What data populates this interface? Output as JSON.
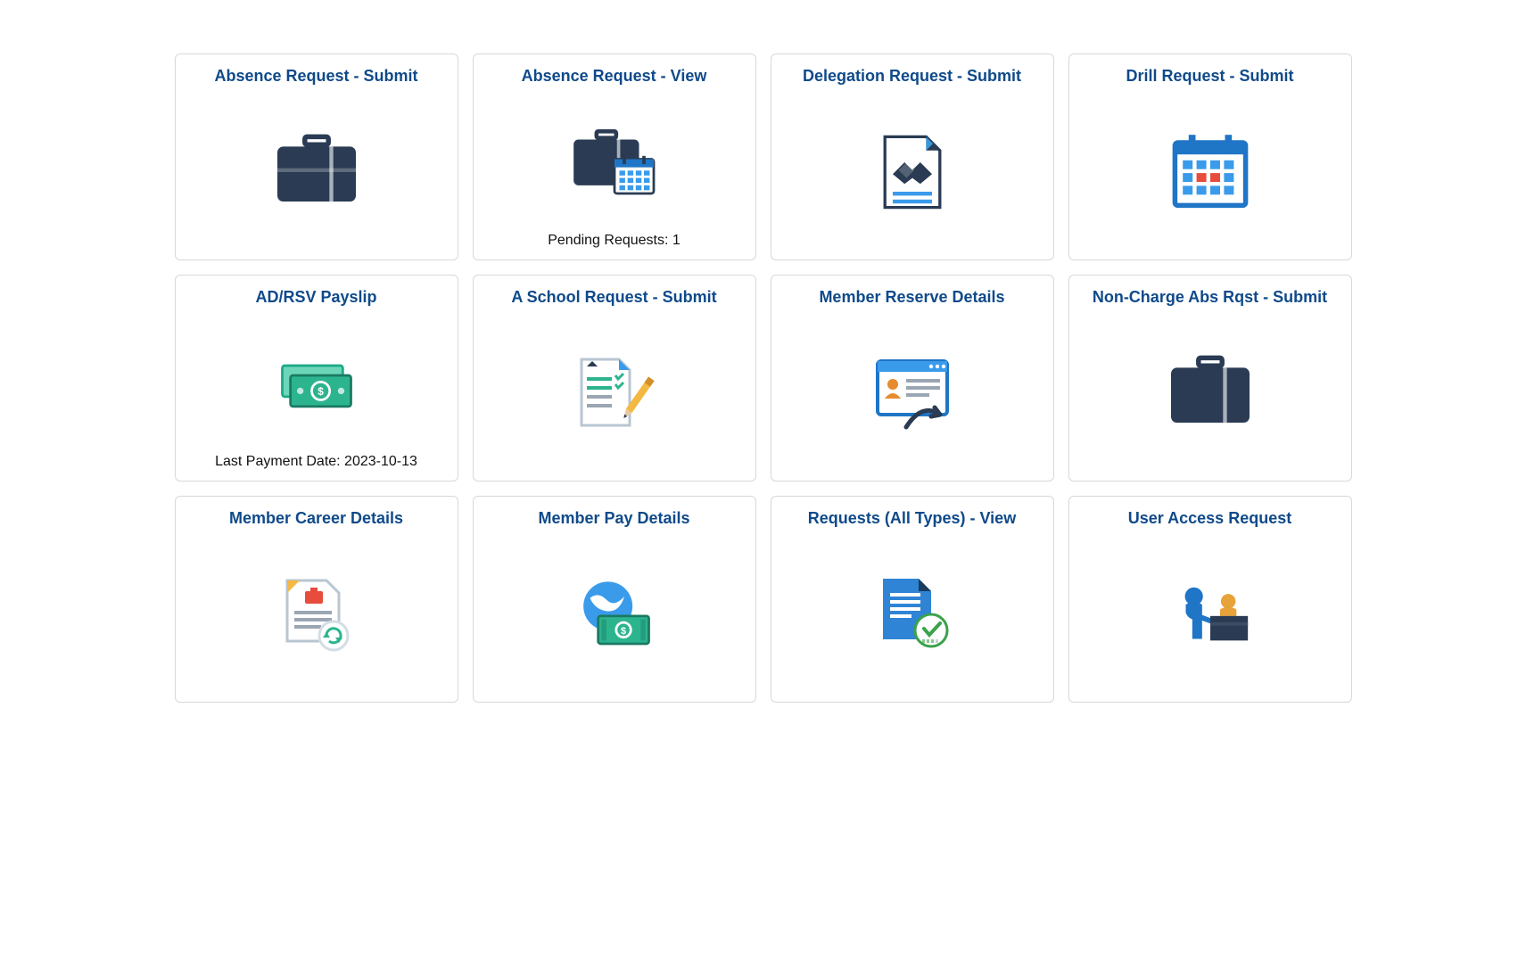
{
  "tiles": [
    {
      "title": "Absence Request - Submit",
      "footer": ""
    },
    {
      "title": "Absence Request - View",
      "footer": "Pending Requests: 1"
    },
    {
      "title": "Delegation Request - Submit",
      "footer": ""
    },
    {
      "title": "Drill Request - Submit",
      "footer": ""
    },
    {
      "title": "AD/RSV Payslip",
      "footer": "Last Payment Date: 2023-10-13"
    },
    {
      "title": "A School Request - Submit",
      "footer": ""
    },
    {
      "title": "Member Reserve Details",
      "footer": ""
    },
    {
      "title": "Non-Charge Abs Rqst - Submit",
      "footer": ""
    },
    {
      "title": "Member Career Details",
      "footer": ""
    },
    {
      "title": "Member Pay Details",
      "footer": ""
    },
    {
      "title": "Requests (All Types) - View",
      "footer": ""
    },
    {
      "title": "User Access Request",
      "footer": ""
    }
  ]
}
